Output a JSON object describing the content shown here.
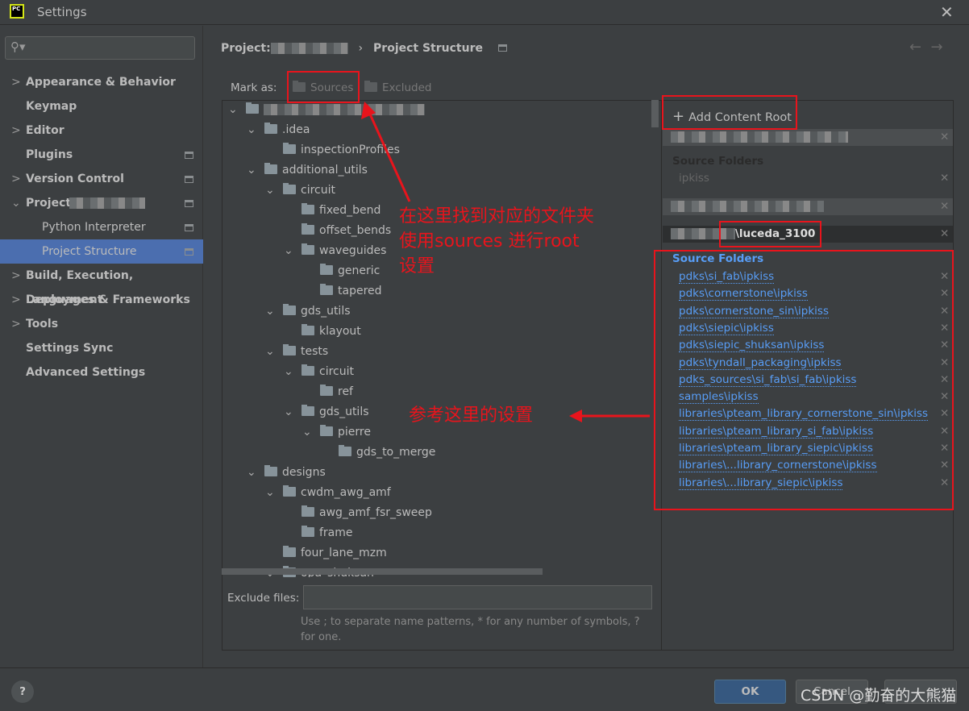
{
  "window": {
    "title": "Settings",
    "app_icon": "pycharm-logo",
    "app_icon_text": "PC"
  },
  "sidebar": {
    "search_placeholder": "",
    "items": [
      {
        "label": "Appearance & Behavior",
        "chevron": "›"
      },
      {
        "label": "Keymap"
      },
      {
        "label": "Editor",
        "chevron": "›"
      },
      {
        "label": "Plugins",
        "badge": true
      },
      {
        "label": "Version Control",
        "chevron": "›",
        "badge": true
      },
      {
        "label": "Project:",
        "chevron": "⌄",
        "badge": true
      },
      {
        "label": "Python Interpreter",
        "badge": true
      },
      {
        "label": "Project Structure",
        "badge": true,
        "selected": true
      },
      {
        "label": "Build, Execution, Deployment",
        "chevron": "›"
      },
      {
        "label": "Languages & Frameworks",
        "chevron": "›"
      },
      {
        "label": "Tools",
        "chevron": "›"
      },
      {
        "label": "Settings Sync"
      },
      {
        "label": "Advanced Settings"
      }
    ]
  },
  "breadcrumb": {
    "project": "Project:",
    "separator": "›",
    "page": "Project Structure"
  },
  "mark_as": {
    "label": "Mark as:",
    "sources": "Sources",
    "excluded": "Excluded"
  },
  "tree": [
    {
      "label": "",
      "level": 0,
      "open": true,
      "blurred": true
    },
    {
      "label": ".idea",
      "level": 1,
      "open": true
    },
    {
      "label": "inspectionProfiles",
      "level": 2
    },
    {
      "label": "additional_utils",
      "level": 1,
      "open": true
    },
    {
      "label": "circuit",
      "level": 2,
      "open": true
    },
    {
      "label": "fixed_bend",
      "level": 3
    },
    {
      "label": "offset_bends",
      "level": 3
    },
    {
      "label": "waveguides",
      "level": 3,
      "open": true
    },
    {
      "label": "generic",
      "level": 4
    },
    {
      "label": "tapered",
      "level": 4
    },
    {
      "label": "gds_utils",
      "level": 2,
      "open": true
    },
    {
      "label": "klayout",
      "level": 3
    },
    {
      "label": "tests",
      "level": 2,
      "open": true
    },
    {
      "label": "circuit",
      "level": 3,
      "open": true
    },
    {
      "label": "ref",
      "level": 4
    },
    {
      "label": "gds_utils",
      "level": 3,
      "open": true
    },
    {
      "label": "pierre",
      "level": 4,
      "open": true
    },
    {
      "label": "gds_to_merge",
      "level": 5
    },
    {
      "label": "designs",
      "level": 1,
      "open": true
    },
    {
      "label": "cwdm_awg_amf",
      "level": 2,
      "open": true
    },
    {
      "label": "awg_amf_fsr_sweep",
      "level": 3
    },
    {
      "label": "frame",
      "level": 3
    },
    {
      "label": "four_lane_mzm",
      "level": 2
    },
    {
      "label": "opa_shuksan",
      "level": 2,
      "open": true
    }
  ],
  "exclude": {
    "label": "Exclude files:",
    "value": "",
    "hint": "Use ; to separate name patterns, * for any number of symbols, ? for one."
  },
  "content_roots": {
    "add_label": "Add Content Root",
    "root1_source_header": "Source Folders",
    "root1_source": "ipkiss",
    "root3_path": "\\luceda_3100",
    "source_header": "Source Folders",
    "sources": [
      "pdks\\si_fab\\ipkiss",
      "pdks\\cornerstone\\ipkiss",
      "pdks\\cornerstone_sin\\ipkiss",
      "pdks\\siepic\\ipkiss",
      "pdks\\siepic_shuksan\\ipkiss",
      "pdks\\tyndall_packaging\\ipkiss",
      "pdks_sources\\si_fab\\si_fab\\ipkiss",
      "samples\\ipkiss",
      "libraries\\pteam_library_cornerstone_sin\\ipkiss",
      "libraries\\pteam_library_si_fab\\ipkiss",
      "libraries\\pteam_library_siepic\\ipkiss",
      "libraries\\...library_cornerstone\\ipkiss",
      "libraries\\...library_siepic\\ipkiss"
    ]
  },
  "footer": {
    "help": "?",
    "ok": "OK",
    "cancel": "Cancel",
    "apply": ""
  },
  "annotations": {
    "note1": "在这里找到对应的文件夹\n使用sources 进行root\n设置",
    "note2": "参考这里的设置",
    "color": "#e8141c"
  },
  "watermark": "CSDN @勤奋的大熊猫",
  "colors": {
    "accent": "#4b6eaf",
    "link": "#589df6",
    "ok_button": "#365880"
  }
}
